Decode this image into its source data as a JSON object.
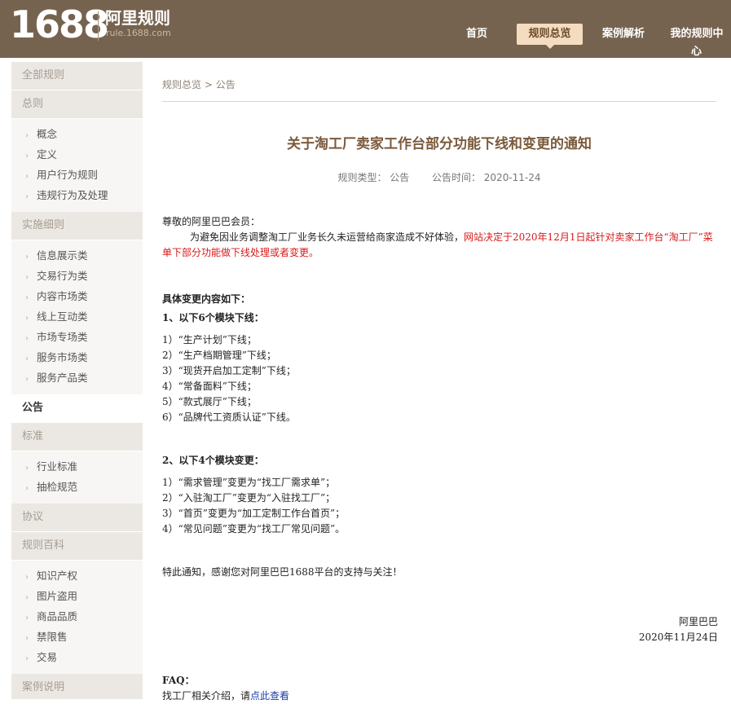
{
  "header": {
    "logo_number": "1688",
    "logo_title": "阿里规则",
    "logo_domain": "rule.1688.com",
    "nav": [
      {
        "label": "首页"
      },
      {
        "label": "规则总览"
      },
      {
        "label": "案例解析"
      },
      {
        "label": "我的规则中"
      }
    ],
    "nav_overflow": "心"
  },
  "sidebar": {
    "top": "全部规则",
    "groups": [
      {
        "title": "总则",
        "items": [
          "概念",
          "定义",
          "用户行为规则",
          "违规行为及处理"
        ]
      },
      {
        "title": "实施细则",
        "items": [
          "信息展示类",
          "交易行为类",
          "内容市场类",
          "线上互动类",
          "市场专场类",
          "服务市场类",
          "服务产品类"
        ]
      },
      {
        "title": "公告",
        "items": []
      },
      {
        "title": "标准",
        "items": [
          "行业标准",
          "抽检规范"
        ]
      },
      {
        "title": "协议",
        "items": []
      },
      {
        "title": "规则百科",
        "items": [
          "知识产权",
          "图片盗用",
          "商品品质",
          "禁限售",
          "交易"
        ]
      },
      {
        "title": "案例说明",
        "items": []
      }
    ]
  },
  "breadcrumb": {
    "root": "规则总览",
    "sep": " > ",
    "current": "公告"
  },
  "article": {
    "title": "关于淘工厂卖家工作台部分功能下线和变更的通知",
    "type_label": "规则类型：",
    "type_value": "公告",
    "time_label": "公告时间：",
    "time_value": "2020-11-24",
    "greeting": "尊敬的阿里巴巴会员：",
    "intro_plain": "为避免因业务调整淘工厂业务长久未运营给商家造成不好体验，",
    "intro_red": "网站决定于2020年12月1日起针对卖家工作台“淘工厂”菜单下部分功能做下线处理或者变更。",
    "changes_heading": "具体变更内容如下：",
    "section1_heading": "1、以下6个模块下线：",
    "section1_items": [
      "1）“生产计划”下线；",
      "2）“生产档期管理”下线；",
      "3）“现货开启加工定制”下线；",
      "4）“常备面料”下线；",
      "5）“款式展厅”下线；",
      "6）“品牌代工资质认证”下线。"
    ],
    "section2_heading": "2、以下4个模块变更：",
    "section2_items": [
      "1）“需求管理”变更为“找工厂需求单”；",
      "2）“入驻淘工厂”变更为“入驻找工厂”；",
      "3）“首页”变更为“加工定制工作台首页”；",
      "4）“常见问题”变更为“找工厂常见问题”。"
    ],
    "closing": "特此通知，感谢您对阿里巴巴1688平台的支持与关注！",
    "signature": "阿里巴巴",
    "date": "2020年11月24日",
    "faq_heading": "FAQ：",
    "faq_text": "找工厂相关介绍，请",
    "faq_link": "点此查看"
  }
}
